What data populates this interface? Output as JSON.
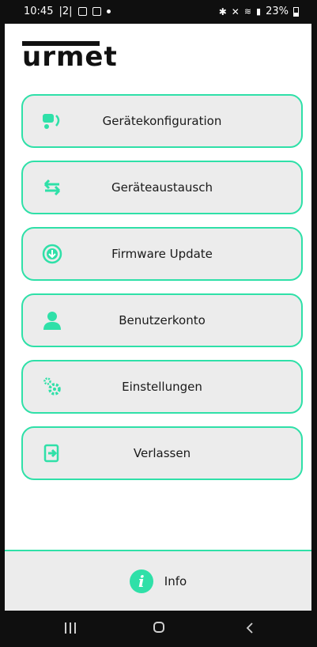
{
  "status_bar": {
    "time": "10:45",
    "indicator": "|2|",
    "battery": "23%"
  },
  "brand": {
    "logo": "urmet"
  },
  "menu": [
    {
      "label": "Gerätekonfiguration",
      "icon": "device-config-icon"
    },
    {
      "label": "Geräteaustausch",
      "icon": "swap-arrows-icon"
    },
    {
      "label": "Firmware Update",
      "icon": "download-circle-icon"
    },
    {
      "label": "Benutzerkonto",
      "icon": "user-icon"
    },
    {
      "label": "Einstellungen",
      "icon": "gears-icon"
    },
    {
      "label": "Verlassen",
      "icon": "exit-icon"
    }
  ],
  "footer": {
    "info_label": "Info",
    "info_glyph": "i"
  },
  "colors": {
    "accent": "#2fe0a8",
    "button_bg": "#ececec"
  }
}
